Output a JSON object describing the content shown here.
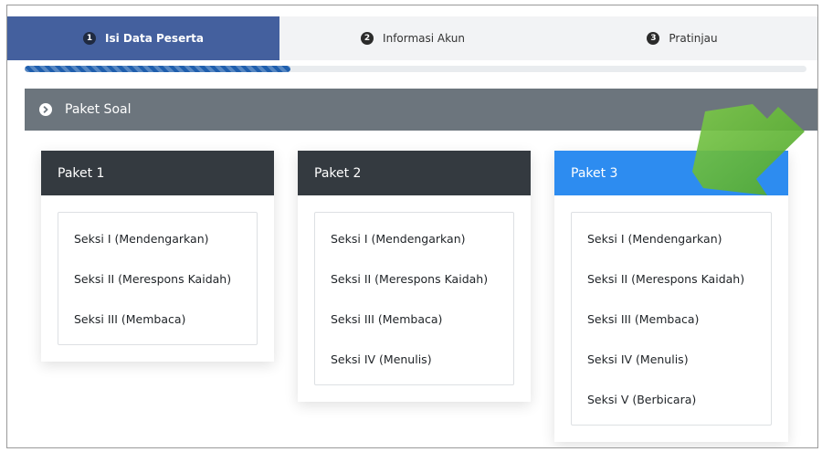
{
  "steps": [
    {
      "num": "1",
      "label": "Isi Data Peserta",
      "active": true
    },
    {
      "num": "2",
      "label": "Informasi Akun",
      "active": false
    },
    {
      "num": "3",
      "label": "Pratinjau",
      "active": false
    }
  ],
  "progress": {
    "fraction": 0.34,
    "color": "#1f5fae"
  },
  "section": {
    "title": "Paket Soal",
    "icon": "chevron-right-circle-icon"
  },
  "packages": [
    {
      "title": "Paket 1",
      "items": [
        "Seksi I (Mendengarkan)",
        "Seksi II (Merespons Kaidah)",
        "Seksi III (Membaca)"
      ]
    },
    {
      "title": "Paket 2",
      "items": [
        "Seksi I (Mendengarkan)",
        "Seksi II (Merespons Kaidah)",
        "Seksi III (Membaca)",
        "Seksi IV (Menulis)"
      ]
    },
    {
      "title": "Paket 3",
      "selected": true,
      "items": [
        "Seksi I (Mendengarkan)",
        "Seksi II (Merespons Kaidah)",
        "Seksi III (Membaca)",
        "Seksi IV (Menulis)",
        "Seksi V (Berbicara)"
      ]
    }
  ],
  "colors": {
    "active_step": "#44609e",
    "card_header": "#343a40",
    "selected_header": "#2d8cf0",
    "section_header": "#6c757d",
    "arrow": "#5cb531"
  },
  "annotation": {
    "icon": "green-arrow-icon"
  }
}
